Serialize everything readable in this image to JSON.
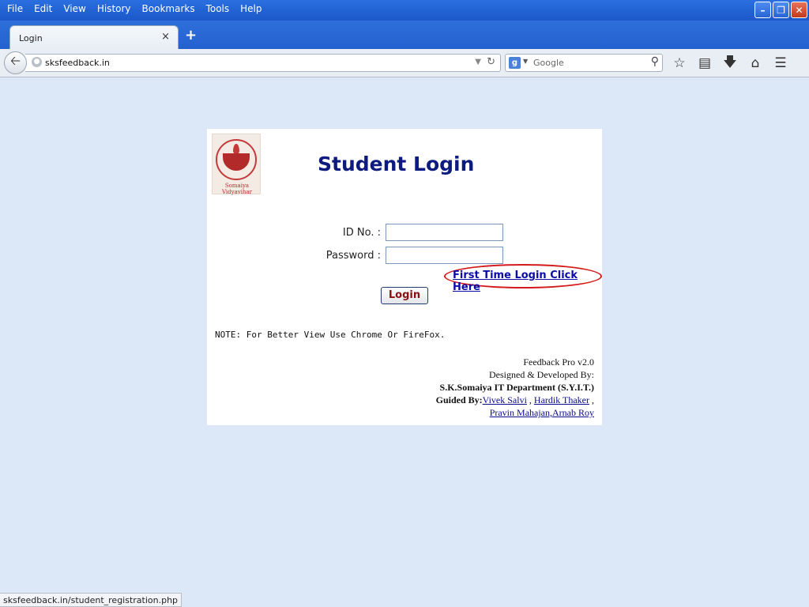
{
  "menu": [
    {
      "label": "File"
    },
    {
      "label": "Edit"
    },
    {
      "label": "View"
    },
    {
      "label": "History"
    },
    {
      "label": "Bookmarks"
    },
    {
      "label": "Tools"
    },
    {
      "label": "Help"
    }
  ],
  "tab": {
    "title": "Login",
    "close": "×"
  },
  "newtab": "+",
  "address": {
    "url": "sksfeedback.in"
  },
  "search": {
    "engine": "Google"
  },
  "page": {
    "title": "Student Login",
    "logo_text": "Somaiya Vidyavihar",
    "id_label": "ID No. :",
    "password_label": "Password :",
    "first_time_link": "First Time Login Click Here",
    "login_button": "Login",
    "note": "NOTE: For Better View Use Chrome Or FireFox.",
    "footer": {
      "version": "Feedback Pro v2.0",
      "designed_by": "Designed & Developed By:",
      "department": "S.K.Somaiya IT Department (S.Y.I.T.)",
      "guided_by": "Guided By:",
      "guide1": "Vivek Salvi",
      "guide2": "Hardik Thaker",
      "guide3": "Pravin Mahajan,Arnab Roy"
    }
  },
  "status": {
    "text": "sksfeedback.in/student_registration.php"
  }
}
